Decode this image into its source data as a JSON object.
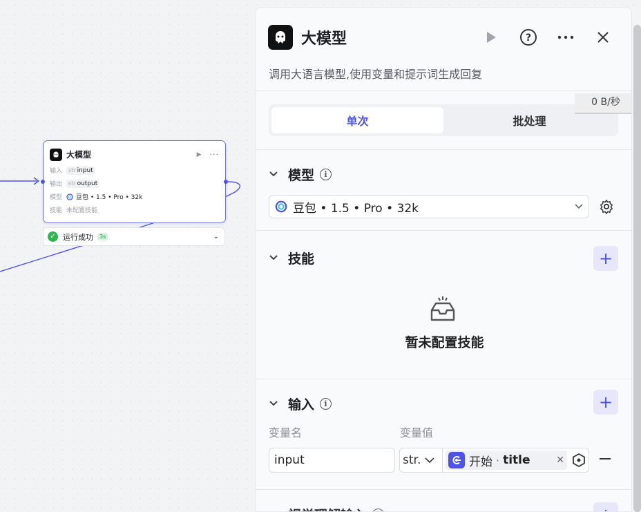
{
  "canvas": {
    "node": {
      "title": "大模型",
      "rows": [
        {
          "key": "输入",
          "type": "str",
          "value": "input"
        },
        {
          "key": "输出",
          "type": "str",
          "value": "output"
        },
        {
          "key": "模型",
          "value": "豆包 • 1.5 • Pro • 32k"
        },
        {
          "key": "技能",
          "value": "未配置技能"
        }
      ]
    },
    "status": {
      "text": "运行成功",
      "time": "3s"
    }
  },
  "panel": {
    "title": "大模型",
    "description": "调用大语言模型,使用变量和提示词生成回复",
    "speed_badge": "0 B/秒",
    "tabs": [
      {
        "label": "单次",
        "active": true
      },
      {
        "label": "批处理",
        "active": false
      }
    ],
    "model_section": {
      "title": "模型",
      "selected": "豆包 • 1.5 • Pro • 32k"
    },
    "skills_section": {
      "title": "技能",
      "empty_text": "暂未配置技能"
    },
    "input_section": {
      "title": "输入",
      "col_name": "变量名",
      "col_value": "变量值",
      "rows": [
        {
          "name": "input",
          "type": "str.",
          "source": "开始",
          "field": "title"
        }
      ]
    },
    "next_section": {
      "title": "视觉理解输入"
    }
  },
  "colors": {
    "accent": "#4d53e8",
    "success": "#31b550",
    "background": "#f2f3f5"
  }
}
